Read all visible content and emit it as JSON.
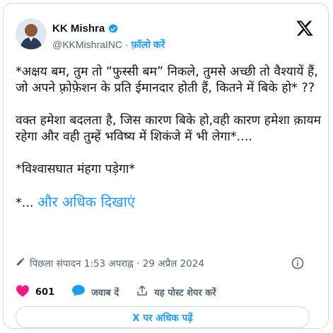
{
  "author": {
    "name": "KK Mishra",
    "handle": "@KKMishraINC",
    "separator": "·",
    "follow_label": "फ़ॉलो करें"
  },
  "tweet": {
    "text": "*अक्षय बम, तुम तो “फुस्सी बम” निकले, तुमसे अच्छी तो वैश्यायें हैं, जो अपने फ़्रोफ़ेशन के प्रति ईमानदार होती हैं, कितने में बिके हो* ??\n\nवक्त हमेशा बदलता है, जिस कारण बिके हो,वही कारण हमेशा क़ायम रहेगा और वही तुम्हें भविष्य में शिकंजे में भी लेगा*....\n\n*विश्वासघात मंहगा पड़ेगा*\n\n",
    "trailing_prefix": "*... ",
    "show_more_label": "और अधिक दिखाएं",
    "edited_label": "पिछला संपादन 1:53 अपराह्न · 29 अप्रैल 2024"
  },
  "actions": {
    "likes": "601",
    "reply_label": "जवाब दें",
    "share_label": "यह पोस्ट शेयर करें",
    "read_more_label": "X पर अधिक पढ़ें"
  },
  "colors": {
    "accent": "#1d9bf0",
    "like": "#f91880",
    "muted": "#536471",
    "text": "#0f1419",
    "border": "#cfd9de"
  },
  "icons": [
    "verified-badge-icon",
    "x-logo-icon",
    "pencil-icon",
    "info-icon",
    "heart-icon",
    "reply-icon",
    "share-icon"
  ]
}
